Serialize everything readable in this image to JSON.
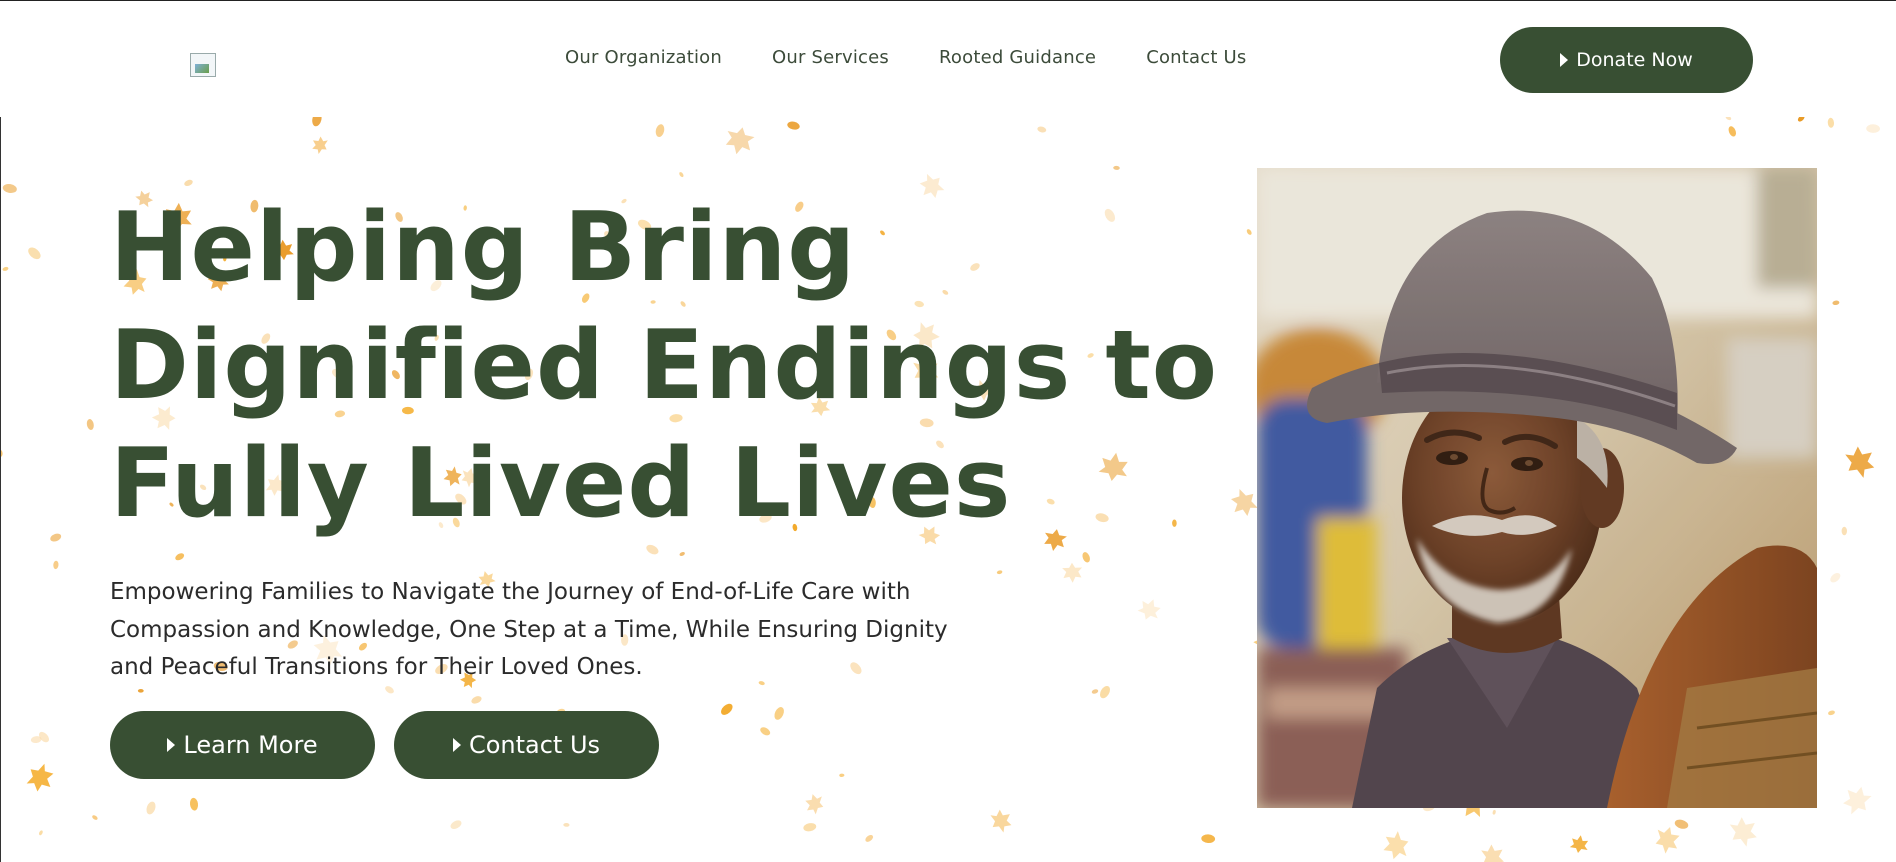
{
  "header": {
    "logo_alt": "",
    "nav": [
      {
        "label": "Our Organization"
      },
      {
        "label": "Our Services"
      },
      {
        "label": "Rooted Guidance"
      },
      {
        "label": "Contact Us"
      }
    ],
    "donate_label": "Donate Now"
  },
  "hero": {
    "headline_lines": [
      "Helping Bring",
      "Dignified Endings to",
      "Fully Lived Lives"
    ],
    "subtext": "Empowering Families to Navigate the Journey of End-of-Life Care with Compassion and Knowledge, One Step at a Time, While Ensuring Dignity and Peaceful Transitions for Their Loved Ones.",
    "buttons": [
      {
        "label": "Learn More"
      },
      {
        "label": "Contact Us"
      }
    ]
  },
  "colors": {
    "brand_green": "#384f33",
    "leaf_orange": "#f2a51f",
    "text_dark": "#2b2b2b"
  },
  "icons": {
    "button_arrow": "play-triangle-icon",
    "logo": "broken-image-icon"
  }
}
